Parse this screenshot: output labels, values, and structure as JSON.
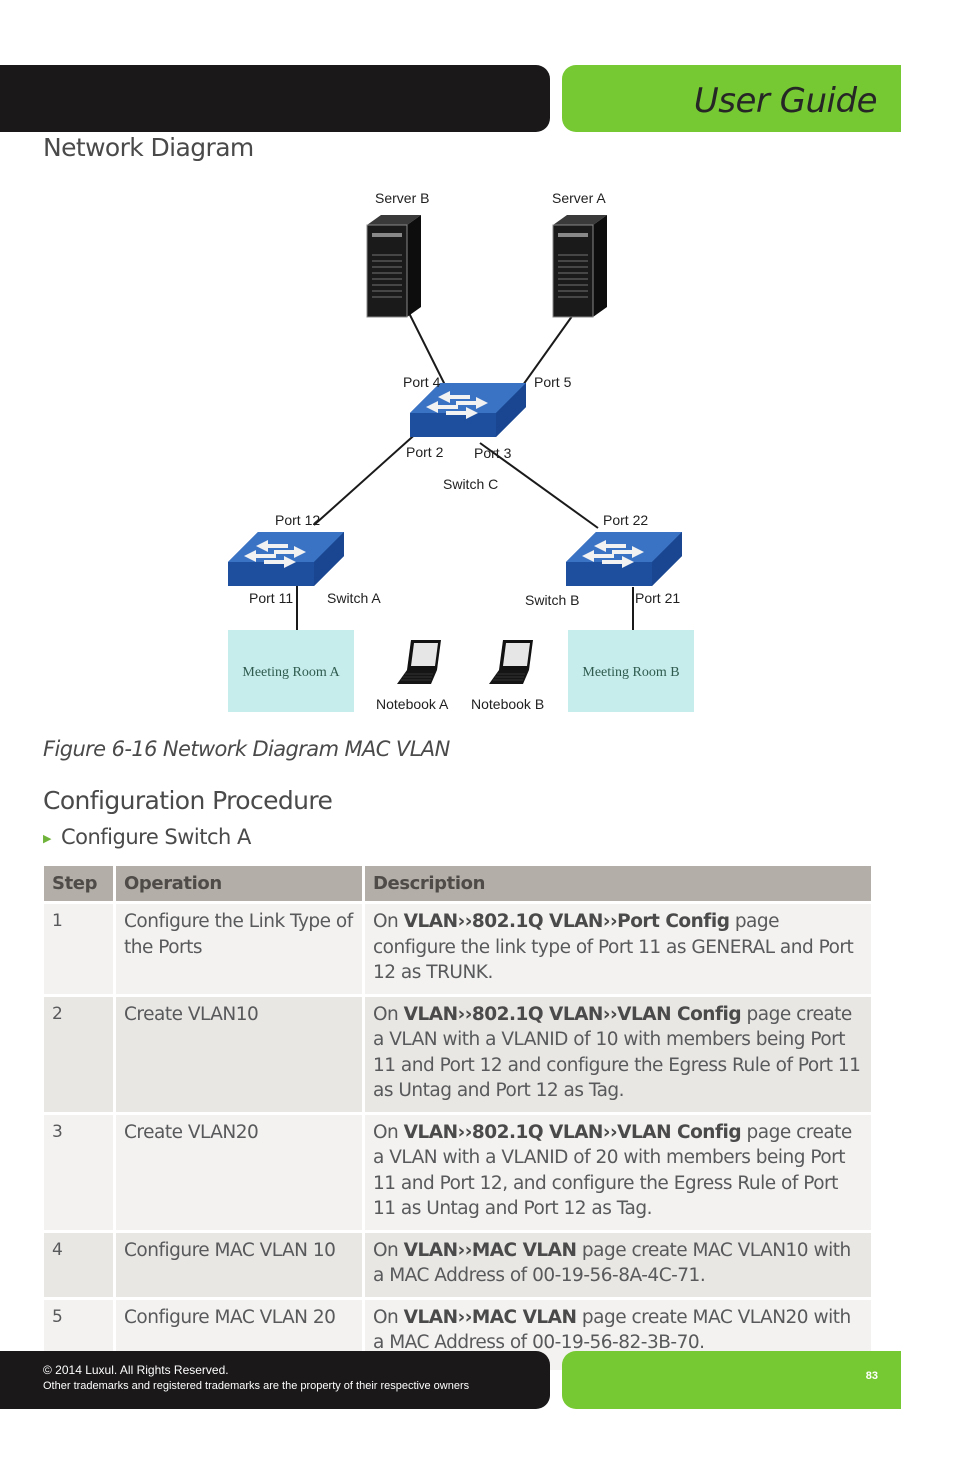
{
  "header": {
    "title": "User Guide"
  },
  "sections": {
    "network_diagram": "Network Diagram",
    "configuration_procedure": "Configuration Procedure"
  },
  "diagram": {
    "servers": [
      {
        "label": "Server B"
      },
      {
        "label": "Server A"
      }
    ],
    "switch_c": {
      "label": "Switch C",
      "ports": {
        "top_left": "Port 4",
        "top_right": "Port 5",
        "bottom_left": "Port 2",
        "bottom_right": "Port 3"
      }
    },
    "switch_a": {
      "label": "Switch A",
      "port_up": "Port 12",
      "port_down": "Port 11"
    },
    "switch_b": {
      "label": "Switch B",
      "port_up": "Port 22",
      "port_down": "Port 21"
    },
    "rooms": [
      {
        "label": "Meeting Room A"
      },
      {
        "label": "Meeting Room B"
      }
    ],
    "notebooks": [
      {
        "label": "Notebook A"
      },
      {
        "label": "Notebook B"
      }
    ],
    "colors": {
      "switch": "#2b5fad",
      "room": "#c7ecec"
    }
  },
  "figure_caption": "Figure 6-16 Network Diagram MAC VLAN",
  "bullet": {
    "icon": "triangle-right-icon",
    "text": "Configure Switch A"
  },
  "table": {
    "headers": [
      "Step",
      "Operation",
      "Description"
    ],
    "rows": [
      {
        "step": "1",
        "operation": "Configure the Link Type of the Ports",
        "desc_prefix": "On ",
        "desc_bold": "VLAN››802.1Q VLAN››Port Config",
        "desc_rest": " page configure the link type of Port 11 as GENERAL and Port 12 as TRUNK."
      },
      {
        "step": "2",
        "operation": "Create VLAN10",
        "desc_prefix": "On ",
        "desc_bold": "VLAN››802.1Q VLAN››VLAN Config",
        "desc_rest": " page create a VLAN with a VLANID of 10 with members being Port 11 and Port 12 and configure the Egress Rule of Port 11 as Untag and Port 12 as Tag."
      },
      {
        "step": "3",
        "operation": "Create VLAN20",
        "desc_prefix": "On ",
        "desc_bold": "VLAN››802.1Q VLAN››VLAN Config",
        "desc_rest": " page create a VLAN with a VLANID of 20 with members being Port 11 and Port 12, and configure the Egress Rule of Port 11 as Untag and Port 12 as Tag."
      },
      {
        "step": "4",
        "operation": "Configure MAC VLAN 10",
        "desc_prefix": "On ",
        "desc_bold": "VLAN››MAC VLAN",
        "desc_rest": " page create MAC VLAN10 with a MAC Address of 00-19-56-8A-4C-71."
      },
      {
        "step": "5",
        "operation": "Configure MAC VLAN 20",
        "desc_prefix": "On ",
        "desc_bold": "VLAN››MAC VLAN",
        "desc_rest": " page create MAC VLAN20 with a MAC Address of 00-19-56-82-3B-70."
      }
    ]
  },
  "footer": {
    "copyright": "© 2014  Luxul. All Rights Reserved.",
    "trademark": "Other trademarks and registered trademarks are the property of their respective owners",
    "page_number": "83"
  },
  "colors": {
    "brand_green": "#76c933",
    "brand_black": "#1a1818",
    "table_header": "#b3aea8"
  }
}
